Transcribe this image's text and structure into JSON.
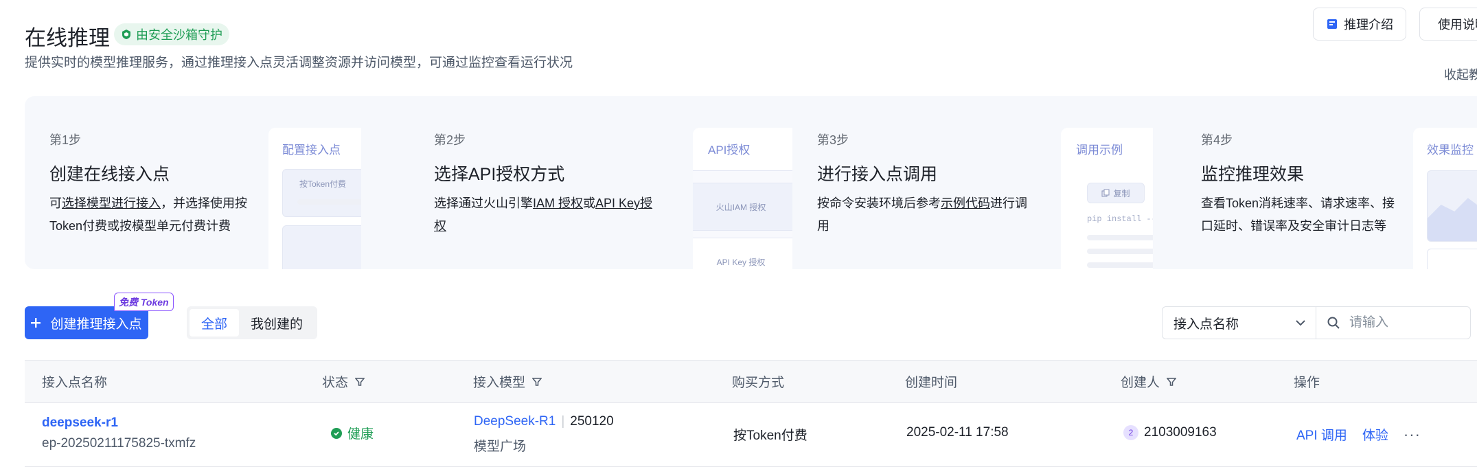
{
  "header": {
    "title": "在线推理",
    "sandbox_badge": "由安全沙箱守护",
    "description": "提供实时的模型推理服务，通过推理接入点灵活调整资源并访问模型，可通过监控查看运行状况",
    "intro_button": "推理介绍",
    "usage_button": "使用说明",
    "collapse_label": "收起教程"
  },
  "steps": [
    {
      "no": "第1步",
      "title": "创建在线接入点",
      "desc_prefix": "可",
      "desc_link": "选择模型进行接入",
      "desc_suffix": "，并选择使用按Token付费或按模型单元付费计费",
      "card_title": "配置接入点",
      "card_mock": "按Token付费"
    },
    {
      "no": "第2步",
      "title": "选择API授权方式",
      "desc_prefix": "选择通过火山引擎",
      "desc_link": "IAM 授权",
      "desc_mid": "或",
      "desc_link2": "API Key授权",
      "card_title": "API授权",
      "card_mock": "火山IAM 授权",
      "card_mock2": "API Key 授权"
    },
    {
      "no": "第3步",
      "title": "进行接入点调用",
      "desc_prefix": "按命令安装环境后参考",
      "desc_link": "示例代码",
      "desc_suffix": "进行调用",
      "card_title": "调用示例",
      "card_mock": "复制",
      "card_code": "pip install --upgrade"
    },
    {
      "no": "第4步",
      "title": "监控推理效果",
      "desc": "查看Token消耗速率、请求速率、接口延时、错误率及安全审计日志等",
      "card_title": "效果监控"
    }
  ],
  "toolbar": {
    "create_button": "创建推理接入点",
    "free_token_badge": "免费 Token",
    "tabs": [
      {
        "label": "全部",
        "active": true
      },
      {
        "label": "我创建的",
        "active": false
      }
    ],
    "filter_field": "接入点名称",
    "search_placeholder": "请输入"
  },
  "table": {
    "columns": [
      "接入点名称",
      "状态",
      "接入模型",
      "购买方式",
      "创建时间",
      "创建人",
      "操作"
    ],
    "rows": [
      {
        "name": "deepseek-r1",
        "id": "ep-20250211175825-txmfz",
        "status": "健康",
        "model": "DeepSeek-R1",
        "model_version": "250120",
        "model_source": "模型广场",
        "purchase": "按Token付费",
        "created_at": "2025-02-11 17:58",
        "creator_avatar": "2",
        "creator": "2103009163",
        "actions": [
          "API 调用",
          "体验"
        ],
        "more": "···"
      }
    ]
  },
  "colors": {
    "primary": "#2e65f5",
    "success": "#1f9d55",
    "banner_bg": "#f6f8fc",
    "free_token": "#6d3be0"
  }
}
